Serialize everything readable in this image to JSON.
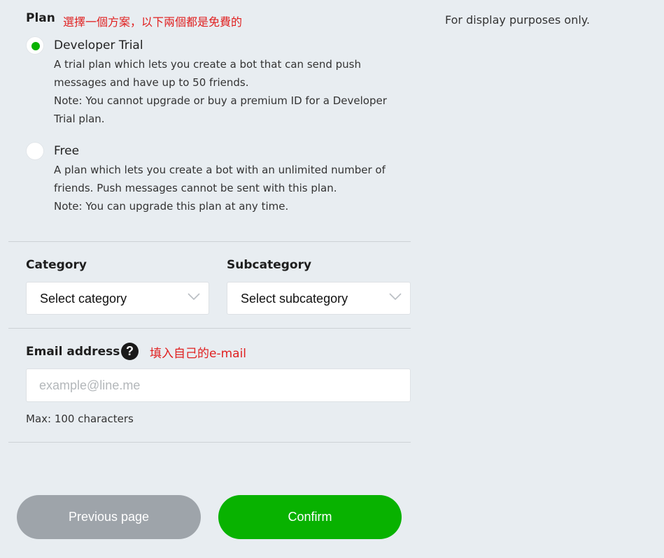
{
  "plan": {
    "label": "Plan",
    "annotation": "選擇一個方案，以下兩個都是免費的",
    "side_note": "For display purposes only.",
    "options": [
      {
        "title": "Developer Trial",
        "selected": true,
        "lines": [
          "A trial plan which lets you create a bot that can send push",
          "messages and have up to 50 friends.",
          "Note: You cannot upgrade or buy a premium ID for a Developer",
          "Trial plan."
        ]
      },
      {
        "title": "Free",
        "selected": false,
        "lines": [
          "A plan which lets you create a bot with an unlimited number of",
          "friends. Push messages cannot be sent with this plan.",
          "Note: You can upgrade this plan at any time."
        ]
      }
    ]
  },
  "category": {
    "label": "Category",
    "value": "Select category"
  },
  "subcategory": {
    "label": "Subcategory",
    "value": "Select subcategory"
  },
  "email": {
    "label": "Email address",
    "help_icon": "question-circle-icon",
    "annotation": "填入自己的e-mail",
    "placeholder": "example@line.me",
    "value": "",
    "hint": "Max: 100 characters"
  },
  "buttons": {
    "previous": "Previous page",
    "confirm": "Confirm"
  },
  "colors": {
    "accent": "#08b200",
    "annotation": "#e02020",
    "secondary_button": "#9ea4aa",
    "background": "#e8edf1"
  }
}
